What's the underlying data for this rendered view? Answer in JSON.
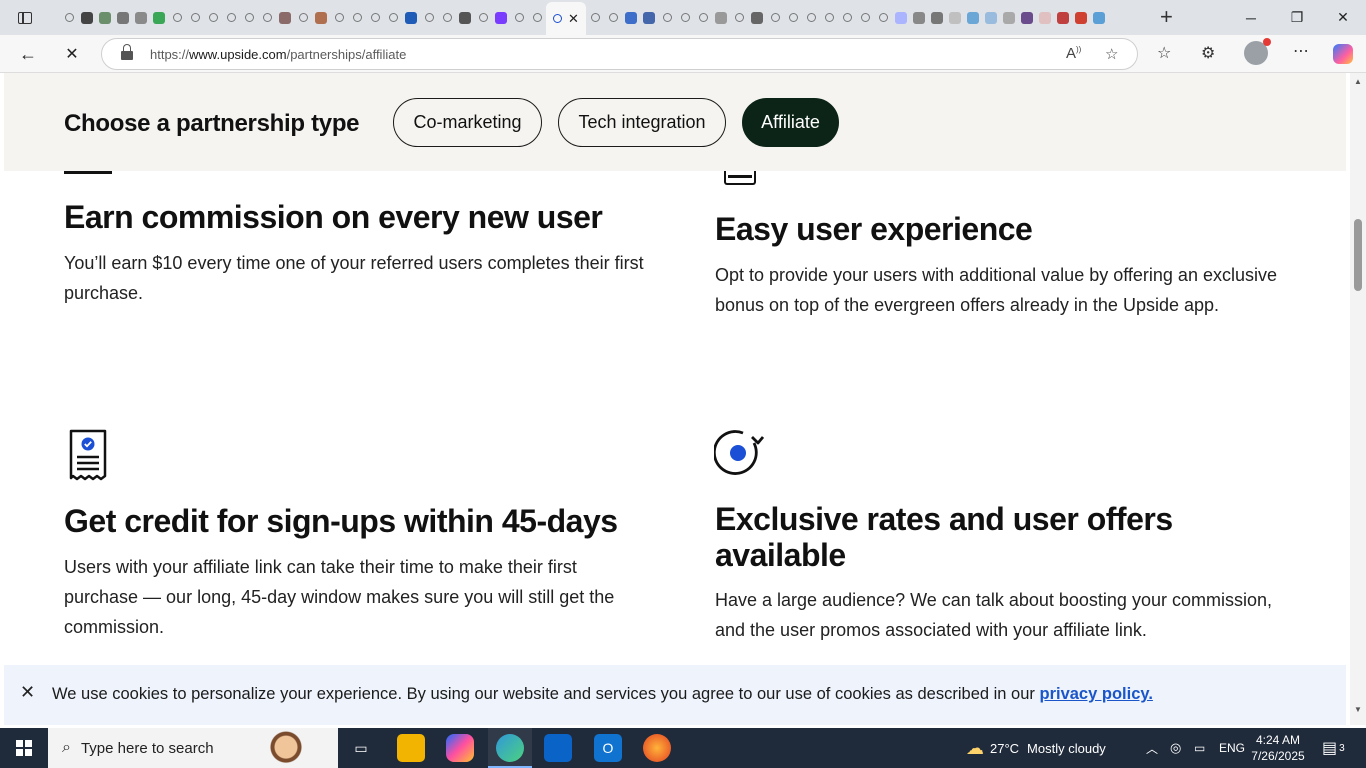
{
  "browser": {
    "url_prefix": "https://",
    "url_host": "www.upside.com",
    "url_path": "/partnerships/affiliate",
    "tab_close": "✕",
    "new_tab": "+",
    "window_controls": [
      "─",
      "❐",
      "✕"
    ],
    "nav": {
      "back": "←",
      "reload": "✕"
    },
    "toolbar_icons": [
      "read-aloud-icon",
      "favorite-star-icon",
      "favorites-icon",
      "extensions-icon",
      "profile-avatar",
      "more-icon",
      "copilot-icon"
    ]
  },
  "partnership": {
    "heading": "Choose a partnership type",
    "options": [
      "Co-marketing",
      "Tech integration",
      "Affiliate"
    ],
    "selected": "Affiliate"
  },
  "features": [
    {
      "title": "Earn commission on every new user",
      "body": "You’ll earn $10 every time one of your referred users completes their first purchase."
    },
    {
      "title": "Easy user experience",
      "body": "Opt to provide your users with additional value by offering an exclusive bonus on top of the evergreen offers already in the Upside app."
    },
    {
      "title": "Get credit for sign-ups within 45-days",
      "body": "Users with your affiliate link can take their time to make their first purchase — our long, 45-day window makes sure you will still get the commission."
    },
    {
      "title": "Exclusive rates and user offers available",
      "body": "Have a large audience? We can talk about boosting your commission, and the user promos associated with your affiliate link."
    }
  ],
  "cookie_banner": {
    "close": "✕",
    "message": "We use cookies to personalize your experience. By using our website and services you agree to our use of cookies as described in our ",
    "link": "privacy policy."
  },
  "taskbar": {
    "search_placeholder": "Type here to search",
    "weather_temp": "27°C",
    "weather_text": "Mostly cloudy",
    "language": "ENG",
    "time": "4:24 AM",
    "date": "7/26/2025",
    "notification_count": "3"
  },
  "colors": {
    "accent_dark": "#0c2418",
    "link": "#1a56c9",
    "icon_blue": "#1a4fd6",
    "banner_bg": "#eef3fc",
    "header_bg": "#f5f4f0"
  }
}
